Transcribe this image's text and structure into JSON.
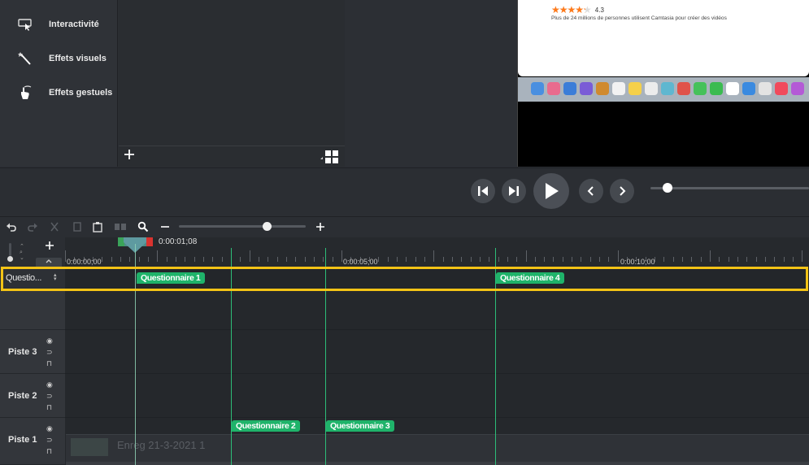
{
  "sidebar": {
    "items": [
      {
        "label": "Interactivité",
        "icon": "cursor-screen-icon"
      },
      {
        "label": "Effets visuels",
        "icon": "magic-wand-icon"
      },
      {
        "label": "Effets gestuels",
        "icon": "hand-gesture-icon"
      }
    ]
  },
  "canvas": {
    "rating": "4.3",
    "stars_fraction": 0.86,
    "caption": "Plus de 24 millions de personnes utilisent Camtasia pour créer des vidéos"
  },
  "timeline": {
    "playhead_time": "0:00:01;08",
    "ruler_labels": [
      "0:00:00;00",
      "0:00:05;00",
      "0:00:10;00"
    ],
    "quiz_track_label": "Questio...",
    "tracks": [
      {
        "name": "Piste 3"
      },
      {
        "name": "Piste 2"
      },
      {
        "name": "Piste 1"
      }
    ],
    "markers": {
      "q1": "Questionnaire 1",
      "q2": "Questionnaire 2",
      "q3": "Questionnaire 3",
      "q4": "Questionnaire 4"
    },
    "clip_label": "Enreg 21-3-2021 1",
    "zoom_level": 0.69
  },
  "colors": {
    "accent_green": "#1fb36a",
    "highlight": "#f3c316",
    "in_marker": "#3aa35a",
    "out_marker": "#d9332f"
  }
}
